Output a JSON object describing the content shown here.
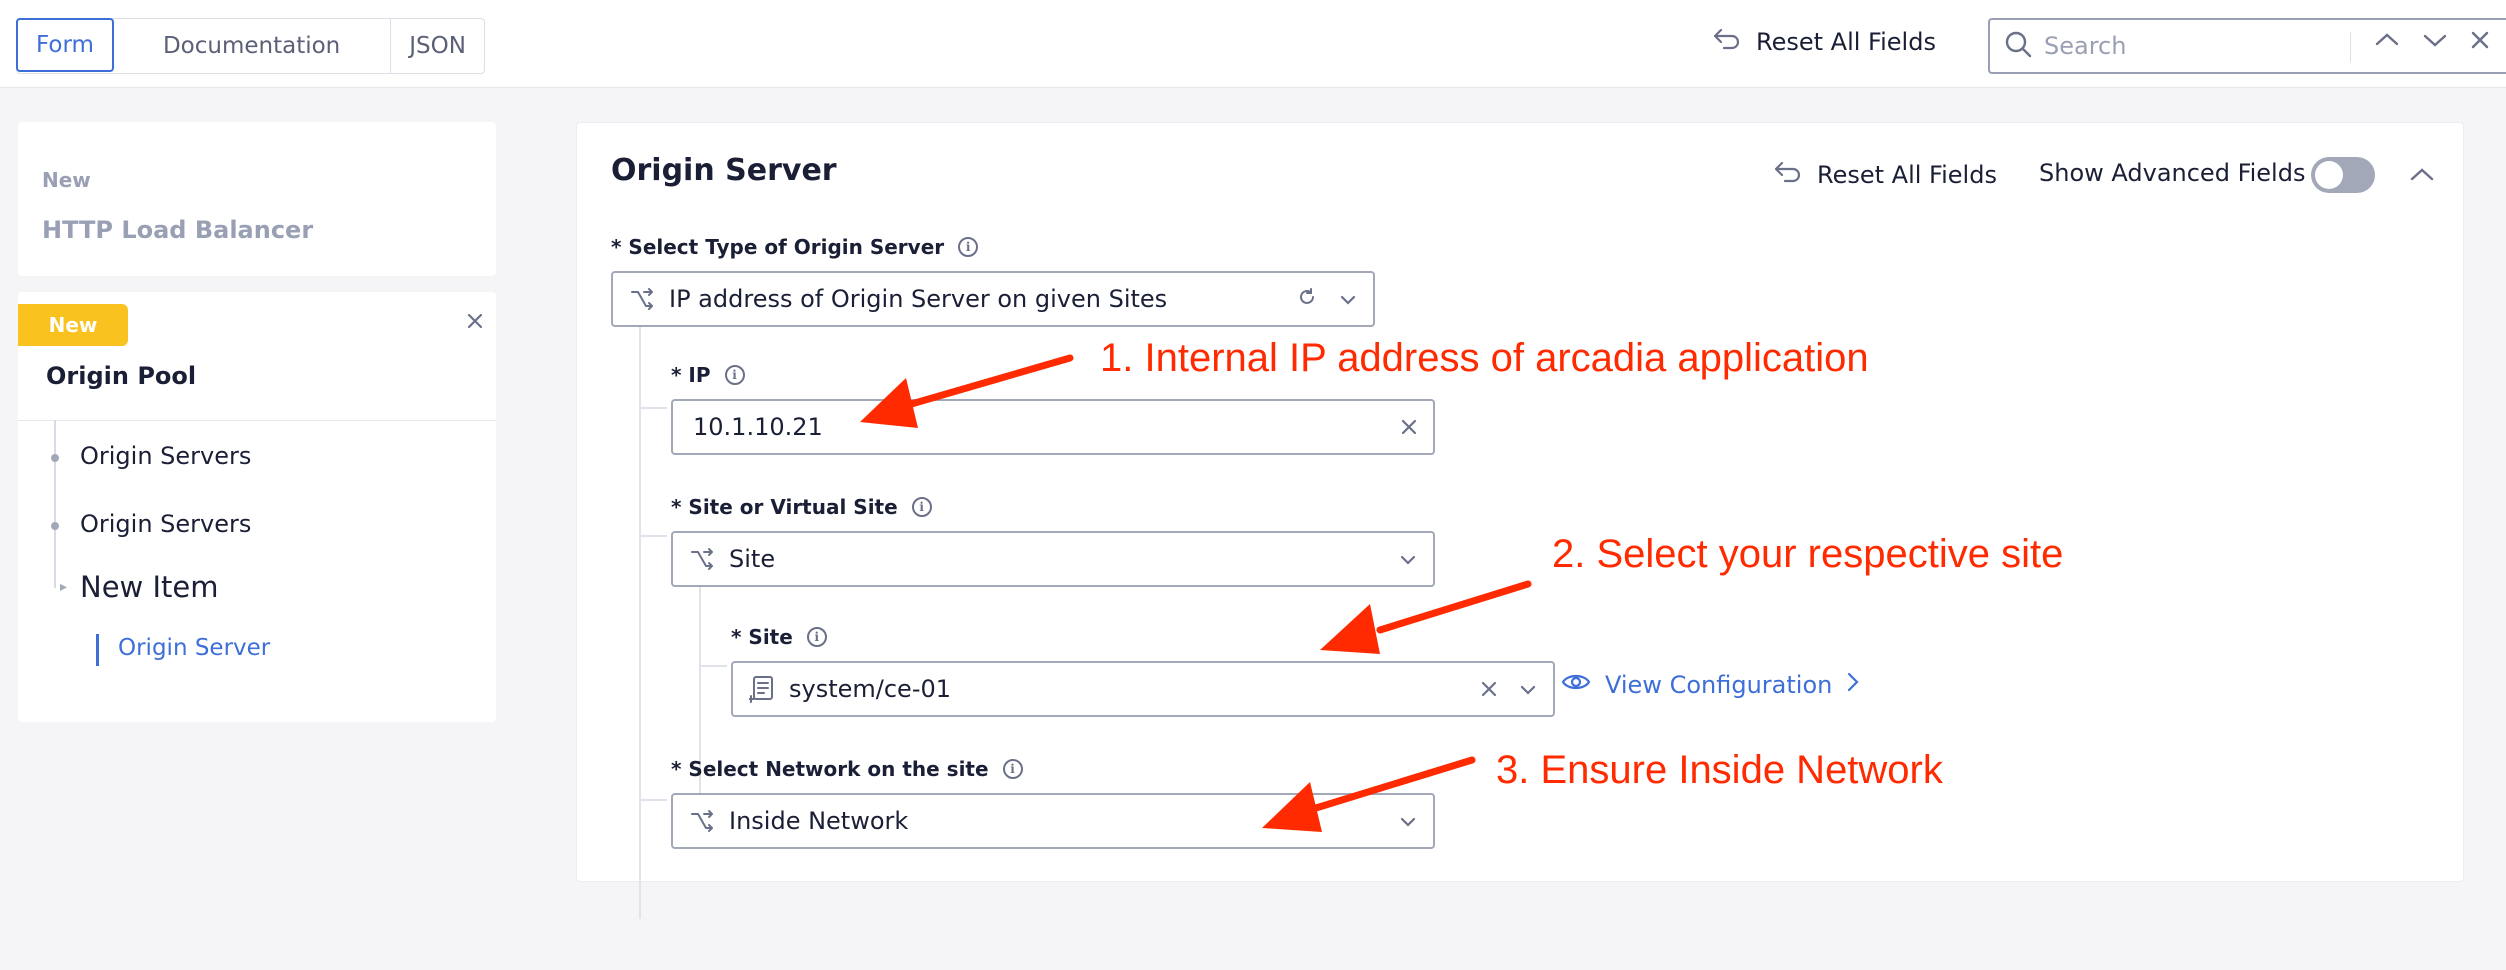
{
  "topbar": {
    "tabs": [
      {
        "label": "Form",
        "active": true
      },
      {
        "label": "Documentation",
        "active": false
      },
      {
        "label": "JSON",
        "active": false
      }
    ],
    "reset_label": "Reset All Fields",
    "search": {
      "placeholder": "Search",
      "value": ""
    }
  },
  "sidebar": {
    "card1": {
      "new_label": "New",
      "title": "HTTP Load Balancer"
    },
    "card2": {
      "badge": "New",
      "title": "Origin Pool",
      "items": [
        {
          "label": "Origin Servers"
        },
        {
          "label": "Origin Servers"
        }
      ],
      "new_item": "New Item",
      "selected": "Origin Server"
    }
  },
  "main": {
    "title": "Origin Server",
    "reset_label": "Reset All Fields",
    "advanced_label": "Show Advanced Fields",
    "advanced_enabled": false,
    "fields": {
      "origin_type": {
        "label": "* Select Type of Origin Server",
        "value": "IP address of Origin Server on given Sites"
      },
      "ip": {
        "label": "* IP",
        "value": "10.1.10.21"
      },
      "site_or_virtual": {
        "label": "* Site or Virtual Site",
        "value": "Site"
      },
      "site": {
        "label": "* Site",
        "value": "system/ce-01"
      },
      "network": {
        "label": "* Select Network on the site",
        "value": "Inside Network"
      }
    },
    "view_config_label": "View Configuration"
  },
  "annotations": [
    "1. Internal IP address of arcadia application",
    "2. Select your respective site",
    "3. Ensure Inside Network"
  ],
  "colors": {
    "accent": "#3e6fd8",
    "badge": "#f9c21e",
    "annotation": "#ff2a00"
  }
}
